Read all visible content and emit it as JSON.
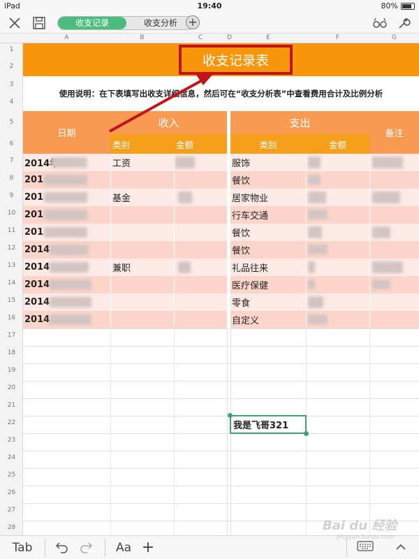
{
  "status": {
    "device": "iPad",
    "time": "19:40",
    "battery": "80%"
  },
  "toolbar": {
    "close_icon": "close-icon",
    "save_icon": "save-icon",
    "tabs": [
      {
        "label": "收支记录",
        "active": true
      },
      {
        "label": "收支分析",
        "active": false
      }
    ],
    "add_sheet_icon": "plus-circle-icon",
    "glasses_icon": "reading-mode-icon",
    "tools_icon": "wrench-icon"
  },
  "sheet": {
    "col_headers": [
      "A",
      "B",
      "C",
      "D",
      "E",
      "F",
      "G"
    ],
    "row_headers": [
      "1",
      "2",
      "3",
      "4",
      "5",
      "6",
      "7",
      "8",
      "9",
      "10",
      "11",
      "12",
      "13",
      "14",
      "15",
      "16",
      "17",
      "18",
      "19",
      "20",
      "21",
      "22",
      "23",
      "24",
      "25",
      "26",
      "27",
      "28"
    ],
    "title": "收支记录表",
    "instructions": "使用说明：在下表填写出收支详细信息，然后可在“收支分析表”中查看费用合计及比例分析",
    "headers": {
      "date": "日期",
      "income": "收入",
      "income_category": "类别",
      "income_amount": "金额",
      "expense": "支出",
      "expense_category": "类别",
      "expense_amount": "金额",
      "note": "备注"
    },
    "rows": [
      {
        "date": "2014年",
        "income_category": "工资",
        "expense_category": "服饰"
      },
      {
        "date": "201",
        "income_category": "",
        "expense_category": "餐饮"
      },
      {
        "date": "201",
        "income_category": "基金",
        "expense_category": "居家物业"
      },
      {
        "date": "201",
        "income_category": "",
        "expense_category": "行车交通"
      },
      {
        "date": "201",
        "income_category": "",
        "expense_category": "餐饮"
      },
      {
        "date": "2014",
        "income_category": "",
        "expense_category": "餐饮"
      },
      {
        "date": "2014",
        "income_category": "兼职",
        "expense_category": "礼品往来"
      },
      {
        "date": "2014",
        "income_category": "",
        "expense_category": "医疗保健"
      },
      {
        "date": "2014",
        "income_category": "",
        "expense_category": "零食"
      },
      {
        "date": "2014",
        "income_category": "",
        "expense_category": "自定义"
      }
    ],
    "selected_cell_text": "我是飞哥321"
  },
  "bottombar": {
    "tab_label": "Tab",
    "undo_icon": "undo-icon",
    "redo_icon": "redo-icon",
    "font_label": "Aa",
    "insert_icon": "plus-icon",
    "keyboard_icon": "keyboard-icon",
    "collapse_icon": "chevron-up-icon"
  },
  "watermark": {
    "text": "Bai du 经验",
    "subtext": "jingyan.baidu.com"
  }
}
